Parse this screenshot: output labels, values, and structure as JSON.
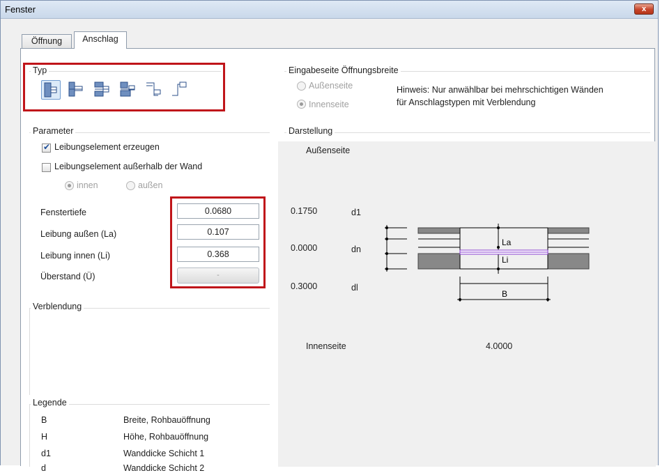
{
  "window": {
    "title": "Fenster",
    "close_glyph": "x"
  },
  "tabs": [
    {
      "label": "Öffnung",
      "active": false
    },
    {
      "label": "Anschlag",
      "active": true
    }
  ],
  "typ": {
    "label": "Typ",
    "icons": [
      "anschlag-typ-1-icon",
      "anschlag-typ-2-icon",
      "anschlag-typ-3-icon",
      "anschlag-typ-4-icon",
      "anschlag-typ-5-icon",
      "anschlag-typ-6-icon"
    ],
    "selected_index": 0
  },
  "eingabeseite": {
    "label": "Eingabeseite Öffnungsbreite",
    "options": [
      {
        "label": "Außenseite",
        "checked": false
      },
      {
        "label": "Innenseite",
        "checked": true
      }
    ],
    "hint_line1": "Hinweis: Nur anwählbar bei mehrschichtigen Wänden",
    "hint_line2": "für Anschlagstypen mit Verblendung"
  },
  "parameter": {
    "label": "Parameter",
    "checkbox_leibung": {
      "label": "Leibungselement erzeugen",
      "checked": true
    },
    "checkbox_ausserhalb": {
      "label": "Leibungselement außerhalb der Wand",
      "checked": false
    },
    "radio_innen": "innen",
    "radio_aussen": "außen",
    "fields": [
      {
        "label": "Fenstertiefe",
        "value": "0.0680"
      },
      {
        "label": "Leibung außen (La)",
        "value": "0.107"
      },
      {
        "label": "Leibung innen (Li)",
        "value": "0.368"
      },
      {
        "label": "Überstand (Ü)",
        "value": "-"
      }
    ]
  },
  "verblendung": {
    "label": "Verblendung"
  },
  "darstellung": {
    "label": "Darstellung",
    "aussenseite": "Außenseite",
    "innenseite": "Innenseite",
    "rows": [
      {
        "value": "0.1750",
        "sym": "d1"
      },
      {
        "value": "0.0000",
        "sym": "dn"
      },
      {
        "value": "0.3000",
        "sym": "dl"
      }
    ],
    "diagram_labels": {
      "la": "La",
      "li": "Li",
      "b": "B"
    },
    "width_value": "4.0000"
  },
  "legende": {
    "label": "Legende",
    "items": [
      {
        "key": "B",
        "desc": "Breite, Rohbauöffnung"
      },
      {
        "key": "H",
        "desc": "Höhe, Rohbauöffnung"
      },
      {
        "key": "d1",
        "desc": "Wanddicke Schicht 1"
      },
      {
        "key": "d",
        "desc": "Wanddicke Schicht 2"
      }
    ]
  }
}
